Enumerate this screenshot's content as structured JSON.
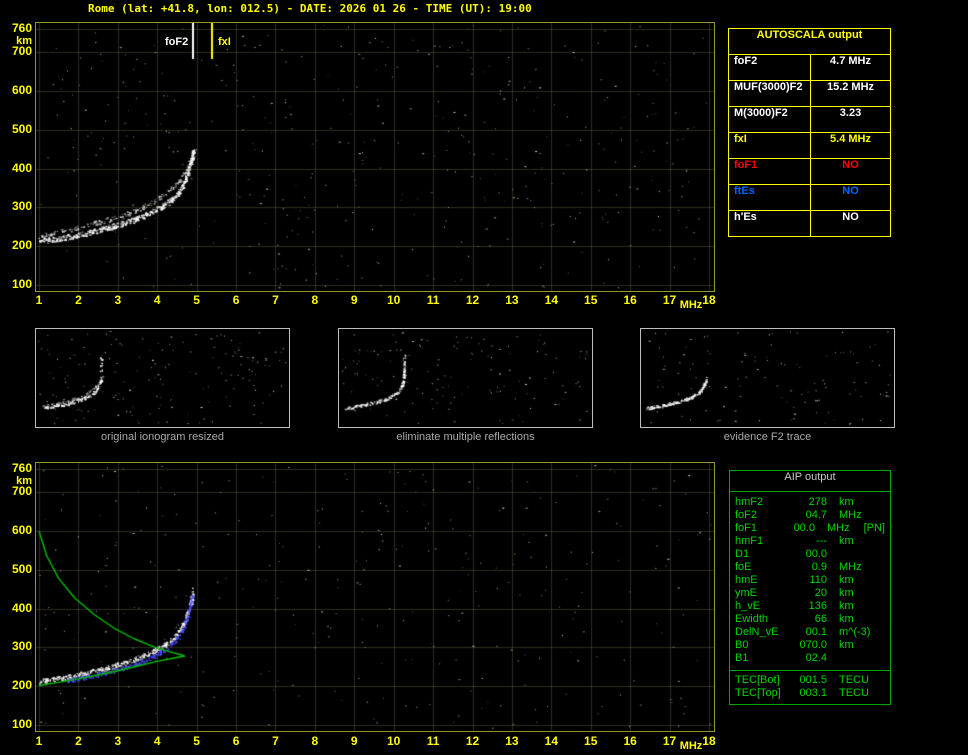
{
  "header": {
    "title": "Rome (lat: +41.8, lon: 012.5) - DATE: 2026 01 26 - TIME (UT): 19:00"
  },
  "colors": {
    "axis_yellow": "#ffff00",
    "table_yellow": "#ffff00",
    "table_green": "#00a800",
    "text_green": "#00d400",
    "alert_red": "#ff0000",
    "es_blue": "#0066ff",
    "trace_white": "#ffffff",
    "fitted_blue": "#4a4aff",
    "profile_green": "#00bf00"
  },
  "axes": {
    "x_ticks": [
      1,
      2,
      3,
      4,
      5,
      6,
      7,
      8,
      9,
      10,
      11,
      12,
      13,
      14,
      15,
      16,
      17,
      18
    ],
    "x_unit": "MHz",
    "y_ticks": [
      760,
      700,
      600,
      500,
      400,
      300,
      200,
      100
    ],
    "y_unit": "km",
    "x_range": [
      1,
      18
    ],
    "y_range": [
      100,
      760
    ]
  },
  "markers": [
    {
      "id": "foF2",
      "label": "foF2",
      "f": 4.9,
      "color": "#ffffff",
      "label_side": "left"
    },
    {
      "id": "fxI",
      "label": "fxI",
      "f": 5.4,
      "color": "#ffff00",
      "label_side": "right"
    }
  ],
  "autoscala": {
    "title": "AUTOSCALA output",
    "rows": [
      {
        "label": "foF2",
        "value": "4.7 MHz",
        "color": "#ffffff"
      },
      {
        "label": "MUF(3000)F2",
        "value": "15.2 MHz",
        "color": "#ffffff"
      },
      {
        "label": "M(3000)F2",
        "value": "3.23",
        "color": "#ffffff"
      },
      {
        "label": "fxI",
        "value": "5.4 MHz",
        "color": "#ffff00"
      },
      {
        "label": "foF1",
        "value": "NO",
        "color": "#ff0000"
      },
      {
        "label": "ftEs",
        "value": "NO",
        "color": "#0066ff"
      },
      {
        "label": "h'Es",
        "value": "NO",
        "color": "#ffffff"
      }
    ]
  },
  "thumbnails": [
    {
      "caption": "original ionogram resized"
    },
    {
      "caption": "eliminate multiple reflections"
    },
    {
      "caption": "evidence F2 trace"
    }
  ],
  "aip": {
    "title": "AIP output",
    "rows": [
      {
        "name": "hmF2",
        "value": "278",
        "unit": "km"
      },
      {
        "name": "foF2",
        "value": "04.7",
        "unit": "MHz"
      },
      {
        "name": "foF1",
        "value": "00.0",
        "unit": "MHz",
        "note": "[PN]"
      },
      {
        "name": "hmF1",
        "value": "---",
        "unit": "km"
      },
      {
        "name": "D1",
        "value": "00.0",
        "unit": ""
      },
      {
        "name": "foE",
        "value": "0.9",
        "unit": "MHz"
      },
      {
        "name": "hmE",
        "value": "110",
        "unit": "km"
      },
      {
        "name": "ymE",
        "value": "20",
        "unit": "km"
      },
      {
        "name": "h_vE",
        "value": "136",
        "unit": "km"
      },
      {
        "name": "Ewidth",
        "value": "66",
        "unit": "km"
      },
      {
        "name": "DelN_vE",
        "value": "00.1",
        "unit": "m^(-3)"
      },
      {
        "name": "B0",
        "value": "070.0",
        "unit": "km"
      },
      {
        "name": "B1",
        "value": "02.4",
        "unit": ""
      }
    ],
    "tec_rows": [
      {
        "name": "TEC[Bot]",
        "value": "001.5",
        "unit": "TECU"
      },
      {
        "name": "TEC[Top]",
        "value": "003.1",
        "unit": "TECU"
      }
    ]
  },
  "chart_data": {
    "type": "scatter",
    "title": "Ionogram with AUTOSCALA interpretation",
    "xlabel": "MHz",
    "ylabel": "km",
    "xlim": [
      1,
      18
    ],
    "ylim": [
      100,
      760
    ],
    "series": [
      {
        "name": "ionogram-o-trace",
        "color": "#ffffff",
        "points": [
          [
            1.0,
            213
          ],
          [
            1.3,
            217
          ],
          [
            1.6,
            222
          ],
          [
            2.0,
            230
          ],
          [
            2.4,
            239
          ],
          [
            2.8,
            250
          ],
          [
            3.2,
            262
          ],
          [
            3.6,
            277
          ],
          [
            3.9,
            291
          ],
          [
            4.2,
            308
          ],
          [
            4.45,
            328
          ],
          [
            4.6,
            350
          ],
          [
            4.72,
            376
          ],
          [
            4.8,
            402
          ],
          [
            4.86,
            430
          ]
        ]
      },
      {
        "name": "ionogram-x-trace",
        "color": "#dddddd",
        "points": [
          [
            1.0,
            227
          ],
          [
            1.5,
            237
          ],
          [
            2.0,
            249
          ],
          [
            2.5,
            262
          ],
          [
            3.0,
            277
          ],
          [
            3.5,
            295
          ],
          [
            3.9,
            316
          ],
          [
            4.2,
            338
          ],
          [
            4.5,
            365
          ],
          [
            4.7,
            392
          ],
          [
            4.85,
            422
          ],
          [
            4.96,
            455
          ]
        ]
      },
      {
        "name": "asymptote-streak",
        "color": "#ffffff",
        "points": [
          [
            4.87,
            412
          ],
          [
            4.9,
            452
          ]
        ]
      },
      {
        "name": "fitted-trace",
        "color": "#4a4aff",
        "points": [
          [
            1.7,
            214
          ],
          [
            2.1,
            222
          ],
          [
            2.5,
            231
          ],
          [
            2.9,
            241
          ],
          [
            3.3,
            253
          ],
          [
            3.7,
            268
          ],
          [
            4.0,
            283
          ],
          [
            4.3,
            303
          ],
          [
            4.5,
            324
          ],
          [
            4.65,
            348
          ],
          [
            4.75,
            376
          ],
          [
            4.82,
            406
          ],
          [
            4.88,
            436
          ]
        ]
      },
      {
        "name": "profile-topside",
        "color": "#00bf00",
        "points": [
          [
            1.0,
            600
          ],
          [
            1.2,
            535
          ],
          [
            1.5,
            478
          ],
          [
            1.9,
            428
          ],
          [
            2.4,
            385
          ],
          [
            2.9,
            350
          ],
          [
            3.4,
            323
          ],
          [
            3.9,
            302
          ],
          [
            4.3,
            289
          ],
          [
            4.6,
            281
          ],
          [
            4.7,
            278
          ]
        ]
      },
      {
        "name": "profile-bottomside",
        "color": "#00bf00",
        "points": [
          [
            1.0,
            202
          ],
          [
            1.5,
            210
          ],
          [
            2.0,
            219
          ],
          [
            2.5,
            229
          ],
          [
            3.0,
            240
          ],
          [
            3.5,
            252
          ],
          [
            4.0,
            264
          ],
          [
            4.4,
            272
          ],
          [
            4.7,
            278
          ]
        ]
      },
      {
        "name": "thumb-streak",
        "color": "#ffffff",
        "points": [
          [
            4.85,
            425
          ],
          [
            4.85,
            600
          ]
        ]
      }
    ]
  }
}
